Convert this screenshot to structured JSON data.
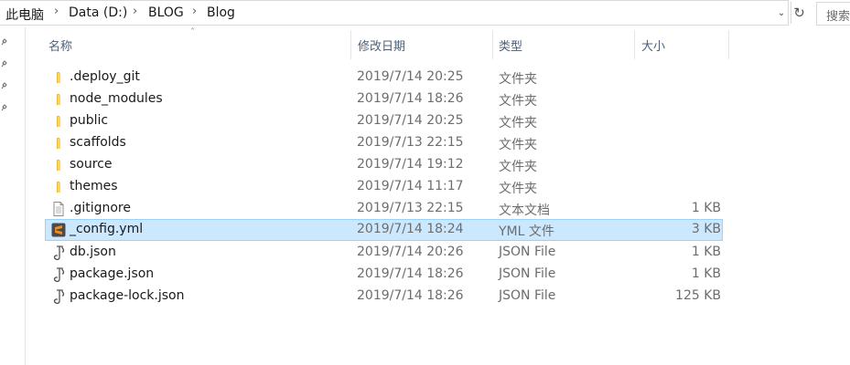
{
  "breadcrumb": {
    "items": [
      {
        "label": "此电脑"
      },
      {
        "label": "Data (D:)"
      },
      {
        "label": "BLOG"
      },
      {
        "label": "Blog"
      }
    ]
  },
  "search": {
    "placeholder": "搜索"
  },
  "columns": {
    "name": "名称",
    "date": "修改日期",
    "type": "类型",
    "size": "大小"
  },
  "files": [
    {
      "name": ".deploy_git",
      "date": "2019/7/14 20:25",
      "type": "文件夹",
      "size": "",
      "icon": "folder-icon"
    },
    {
      "name": "node_modules",
      "date": "2019/7/14 18:26",
      "type": "文件夹",
      "size": "",
      "icon": "folder-icon"
    },
    {
      "name": "public",
      "date": "2019/7/14 20:25",
      "type": "文件夹",
      "size": "",
      "icon": "folder-icon"
    },
    {
      "name": "scaffolds",
      "date": "2019/7/13 22:15",
      "type": "文件夹",
      "size": "",
      "icon": "folder-icon"
    },
    {
      "name": "source",
      "date": "2019/7/14 19:12",
      "type": "文件夹",
      "size": "",
      "icon": "folder-icon"
    },
    {
      "name": "themes",
      "date": "2019/7/14 11:17",
      "type": "文件夹",
      "size": "",
      "icon": "folder-icon"
    },
    {
      "name": ".gitignore",
      "date": "2019/7/13 22:15",
      "type": "文本文档",
      "size": "1 KB",
      "icon": "text-file-icon"
    },
    {
      "name": "_config.yml",
      "date": "2019/7/14 18:24",
      "type": "YML 文件",
      "size": "3 KB",
      "icon": "sublime-file-icon",
      "selected": true
    },
    {
      "name": "db.json",
      "date": "2019/7/14 20:26",
      "type": "JSON File",
      "size": "1 KB",
      "icon": "json-file-icon"
    },
    {
      "name": "package.json",
      "date": "2019/7/14 18:26",
      "type": "JSON File",
      "size": "1 KB",
      "icon": "json-file-icon"
    },
    {
      "name": "package-lock.json",
      "date": "2019/7/14 18:26",
      "type": "JSON File",
      "size": "125 KB",
      "icon": "json-file-icon"
    }
  ],
  "colors": {
    "selection_bg": "#cce8ff",
    "selection_border": "#99d1ff",
    "folder": "#ffd45e",
    "header_text": "#4c607a",
    "sublime_orange": "#f48c1c"
  }
}
